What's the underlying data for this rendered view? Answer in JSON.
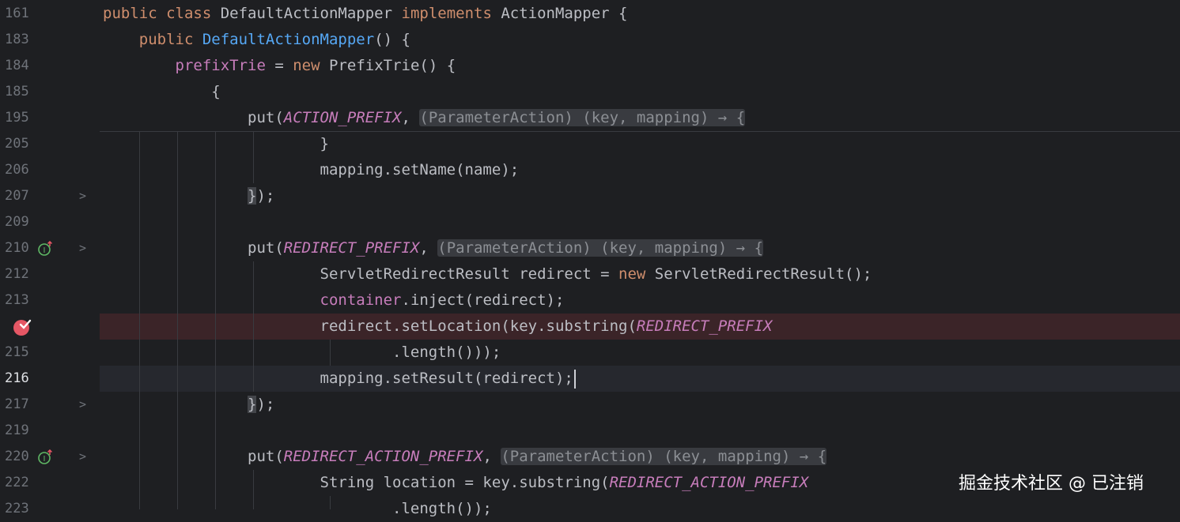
{
  "editor": {
    "lines": [
      {
        "n": "161",
        "text": "public class DefaultActionMapper implements ActionMapper {"
      },
      {
        "n": "183",
        "text": "    public DefaultActionMapper() {"
      },
      {
        "n": "184",
        "text": "        prefixTrie = new PrefixTrie() {"
      },
      {
        "n": "185",
        "text": "            {"
      },
      {
        "n": "195",
        "text": "                put(ACTION_PREFIX, (ParameterAction) (key, mapping) → {"
      },
      {
        "n": "205",
        "text": "                        }"
      },
      {
        "n": "206",
        "text": "                        mapping.setName(name);"
      },
      {
        "n": "207",
        "text": "                });"
      },
      {
        "n": "209",
        "text": ""
      },
      {
        "n": "210",
        "text": "                put(REDIRECT_PREFIX, (ParameterAction) (key, mapping) → {"
      },
      {
        "n": "212",
        "text": "                        ServletRedirectResult redirect = new ServletRedirectResult();"
      },
      {
        "n": "213",
        "text": "                        container.inject(redirect);"
      },
      {
        "n": "",
        "text": "                        redirect.setLocation(key.substring(REDIRECT_PREFIX"
      },
      {
        "n": "215",
        "text": "                                .length()));"
      },
      {
        "n": "216",
        "text": "                        mapping.setResult(redirect);"
      },
      {
        "n": "217",
        "text": "                });"
      },
      {
        "n": "219",
        "text": ""
      },
      {
        "n": "220",
        "text": "                put(REDIRECT_ACTION_PREFIX, (ParameterAction) (key, mapping) → {"
      },
      {
        "n": "222",
        "text": "                        String location = key.substring(REDIRECT_ACTION_PREFIX"
      },
      {
        "n": "223",
        "text": "                                .length());"
      }
    ]
  },
  "watermark": "掘金技术社区 @ 已注销",
  "colors": {
    "background": "#1e1f22",
    "keyword": "#cf8e6d",
    "function": "#56a8f5",
    "field": "#c77dbb",
    "breakpoint_line": "#3b2428",
    "breakpoint": "#e55765"
  }
}
